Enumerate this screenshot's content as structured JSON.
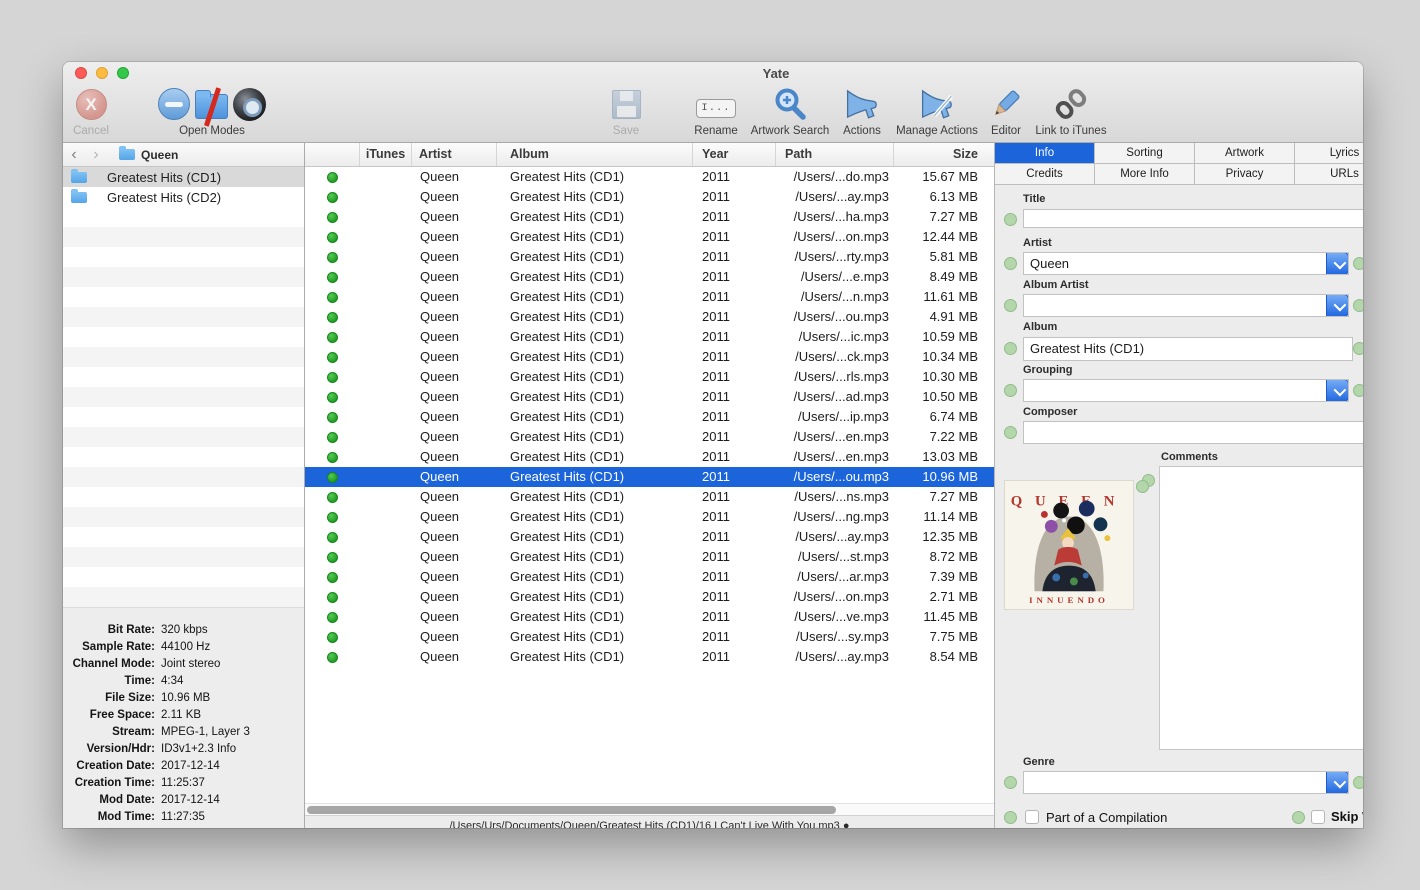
{
  "window": {
    "title": "Yate"
  },
  "toolbar": {
    "cancel": "Cancel",
    "open_modes": "Open Modes",
    "save": "Save",
    "rename": "Rename",
    "rename_icon_text": "I...",
    "artwork_search": "Artwork Search",
    "actions": "Actions",
    "manage_actions": "Manage Actions",
    "editor": "Editor",
    "link_itunes": "Link to iTunes"
  },
  "sidebar": {
    "breadcrumb": "Queen",
    "folders": [
      {
        "label": "Greatest Hits (CD1)",
        "selected": true
      },
      {
        "label": "Greatest Hits (CD2)",
        "selected": false
      }
    ],
    "empty_rows": 20,
    "details": [
      {
        "label": "Bit Rate:",
        "value": "320 kbps"
      },
      {
        "label": "Sample Rate:",
        "value": "44100 Hz"
      },
      {
        "label": "Channel Mode:",
        "value": "Joint stereo"
      },
      {
        "label": "Time:",
        "value": "4:34"
      },
      {
        "label": "File Size:",
        "value": "10.96 MB"
      },
      {
        "label": "Free Space:",
        "value": "2.11 KB"
      },
      {
        "label": "Stream:",
        "value": "MPEG-1, Layer 3"
      },
      {
        "label": "Version/Hdr:",
        "value": "ID3v1+2.3 Info"
      },
      {
        "label": "Creation Date:",
        "value": "2017-12-14"
      },
      {
        "label": "Creation Time:",
        "value": "11:25:37"
      },
      {
        "label": "Mod Date:",
        "value": "2017-12-14"
      },
      {
        "label": "Mod Time:",
        "value": "11:27:35"
      }
    ]
  },
  "table": {
    "columns": {
      "status": "",
      "itunes": "iTunes",
      "artist": "Artist",
      "album": "Album",
      "year": "Year",
      "path": "Path",
      "size": "Size"
    },
    "rows": [
      {
        "artist": "Queen",
        "album": "Greatest Hits (CD1)",
        "year": "2011",
        "path": "/Users/...do.mp3",
        "size": "15.67 MB",
        "selected": false
      },
      {
        "artist": "Queen",
        "album": "Greatest Hits (CD1)",
        "year": "2011",
        "path": "/Users/...ay.mp3",
        "size": "6.13 MB",
        "selected": false
      },
      {
        "artist": "Queen",
        "album": "Greatest Hits (CD1)",
        "year": "2011",
        "path": "/Users/...ha.mp3",
        "size": "7.27 MB",
        "selected": false
      },
      {
        "artist": "Queen",
        "album": "Greatest Hits (CD1)",
        "year": "2011",
        "path": "/Users/...on.mp3",
        "size": "12.44 MB",
        "selected": false
      },
      {
        "artist": "Queen",
        "album": "Greatest Hits (CD1)",
        "year": "2011",
        "path": "/Users/...rty.mp3",
        "size": "5.81 MB",
        "selected": false
      },
      {
        "artist": "Queen",
        "album": "Greatest Hits (CD1)",
        "year": "2011",
        "path": "/Users/...e.mp3",
        "size": "8.49 MB",
        "selected": false
      },
      {
        "artist": "Queen",
        "album": "Greatest Hits (CD1)",
        "year": "2011",
        "path": "/Users/...n.mp3",
        "size": "11.61 MB",
        "selected": false
      },
      {
        "artist": "Queen",
        "album": "Greatest Hits (CD1)",
        "year": "2011",
        "path": "/Users/...ou.mp3",
        "size": "4.91 MB",
        "selected": false
      },
      {
        "artist": "Queen",
        "album": "Greatest Hits (CD1)",
        "year": "2011",
        "path": "/Users/...ic.mp3",
        "size": "10.59 MB",
        "selected": false
      },
      {
        "artist": "Queen",
        "album": "Greatest Hits (CD1)",
        "year": "2011",
        "path": "/Users/...ck.mp3",
        "size": "10.34 MB",
        "selected": false
      },
      {
        "artist": "Queen",
        "album": "Greatest Hits (CD1)",
        "year": "2011",
        "path": "/Users/...rls.mp3",
        "size": "10.30 MB",
        "selected": false
      },
      {
        "artist": "Queen",
        "album": "Greatest Hits (CD1)",
        "year": "2011",
        "path": "/Users/...ad.mp3",
        "size": "10.50 MB",
        "selected": false
      },
      {
        "artist": "Queen",
        "album": "Greatest Hits (CD1)",
        "year": "2011",
        "path": "/Users/...ip.mp3",
        "size": "6.74 MB",
        "selected": false
      },
      {
        "artist": "Queen",
        "album": "Greatest Hits (CD1)",
        "year": "2011",
        "path": "/Users/...en.mp3",
        "size": "7.22 MB",
        "selected": false
      },
      {
        "artist": "Queen",
        "album": "Greatest Hits (CD1)",
        "year": "2011",
        "path": "/Users/...en.mp3",
        "size": "13.03 MB",
        "selected": false
      },
      {
        "artist": "Queen",
        "album": "Greatest Hits (CD1)",
        "year": "2011",
        "path": "/Users/...ou.mp3",
        "size": "10.96 MB",
        "selected": true
      },
      {
        "artist": "Queen",
        "album": "Greatest Hits (CD1)",
        "year": "2011",
        "path": "/Users/...ns.mp3",
        "size": "7.27 MB",
        "selected": false
      },
      {
        "artist": "Queen",
        "album": "Greatest Hits (CD1)",
        "year": "2011",
        "path": "/Users/...ng.mp3",
        "size": "11.14 MB",
        "selected": false
      },
      {
        "artist": "Queen",
        "album": "Greatest Hits (CD1)",
        "year": "2011",
        "path": "/Users/...ay.mp3",
        "size": "12.35 MB",
        "selected": false
      },
      {
        "artist": "Queen",
        "album": "Greatest Hits (CD1)",
        "year": "2011",
        "path": "/Users/...st.mp3",
        "size": "8.72 MB",
        "selected": false
      },
      {
        "artist": "Queen",
        "album": "Greatest Hits (CD1)",
        "year": "2011",
        "path": "/Users/...ar.mp3",
        "size": "7.39 MB",
        "selected": false
      },
      {
        "artist": "Queen",
        "album": "Greatest Hits (CD1)",
        "year": "2011",
        "path": "/Users/...on.mp3",
        "size": "2.71 MB",
        "selected": false
      },
      {
        "artist": "Queen",
        "album": "Greatest Hits (CD1)",
        "year": "2011",
        "path": "/Users/...ve.mp3",
        "size": "11.45 MB",
        "selected": false
      },
      {
        "artist": "Queen",
        "album": "Greatest Hits (CD1)",
        "year": "2011",
        "path": "/Users/...sy.mp3",
        "size": "7.75 MB",
        "selected": false
      },
      {
        "artist": "Queen",
        "album": "Greatest Hits (CD1)",
        "year": "2011",
        "path": "/Users/...ay.mp3",
        "size": "8.54 MB",
        "selected": false
      }
    ]
  },
  "status_bar": {
    "text": "/Users/Urs/Documents/Queen/Greatest Hits (CD1)/16 I Can't Live With You.mp3 ●"
  },
  "inspector": {
    "tabs_row1": [
      {
        "label": "Info",
        "selected": true
      },
      {
        "label": "Sorting",
        "selected": false
      },
      {
        "label": "Artwork",
        "selected": false
      },
      {
        "label": "Lyrics",
        "selected": false
      }
    ],
    "tabs_row2": [
      {
        "label": "Credits",
        "selected": false
      },
      {
        "label": "More Info",
        "selected": false
      },
      {
        "label": "Privacy",
        "selected": false
      },
      {
        "label": "URLs",
        "selected": false
      }
    ],
    "fields": {
      "title": {
        "label": "Title",
        "value": ""
      },
      "artist": {
        "label": "Artist",
        "value": "Queen"
      },
      "album_artist": {
        "label": "Album Artist",
        "value": ""
      },
      "album": {
        "label": "Album",
        "value": "Greatest Hits (CD1)"
      },
      "grouping": {
        "label": "Grouping",
        "value": ""
      },
      "composer": {
        "label": "Composer",
        "value": ""
      },
      "comments": {
        "label": "Comments",
        "value": ""
      },
      "genre": {
        "label": "Genre",
        "value": ""
      }
    },
    "artwork": {
      "album_title": "QUEEN",
      "album_subtitle": "INNUENDO"
    },
    "compilation_label": "Part of a Compilation",
    "skip_label": "Skip When Shuffling"
  },
  "colors": {
    "accent_blue": "#1b64d9",
    "status_green": "#2fae2f",
    "indicator_green": "#b3d6aa",
    "cancel_red": "#cf6a5f"
  }
}
